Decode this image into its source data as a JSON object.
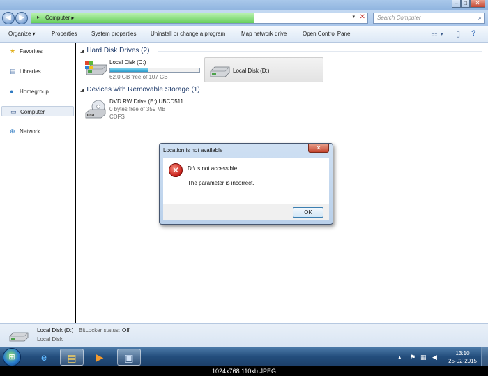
{
  "window": {
    "controls": {
      "minimize": "‒",
      "maximize": "□",
      "close": "✕"
    }
  },
  "address": {
    "arrow": "▸",
    "path": "Computer",
    "separator": "▸",
    "search_placeholder": "Search Computer"
  },
  "toolbar": {
    "items": [
      "Organize ▾",
      "Properties",
      "System properties",
      "Uninstall or change a program",
      "Map network drive",
      "Open Control Panel"
    ]
  },
  "nav": {
    "items": [
      {
        "label": "Favorites",
        "icon": "star-icon"
      },
      {
        "label": "Libraries",
        "icon": "library-icon"
      },
      {
        "label": "Homegroup",
        "icon": "homegroup-icon"
      },
      {
        "label": "Computer",
        "icon": "computer-icon",
        "selected": true
      },
      {
        "label": "Network",
        "icon": "network-icon"
      }
    ]
  },
  "content": {
    "groups": [
      {
        "label": "Hard Disk Drives (2)"
      },
      {
        "label": "Devices with Removable Storage (1)"
      }
    ],
    "drives": {
      "c": {
        "name": "Local Disk (C:)",
        "free": "62.0 GB free of 107 GB",
        "used_fraction": 0.42
      },
      "d": {
        "name": "Local Disk (D:)"
      },
      "e": {
        "name": "DVD RW Drive (E:) UBCD511",
        "free": "0 bytes free of 359 MB",
        "fs": "CDFS"
      }
    }
  },
  "dialog": {
    "title": "Location is not available",
    "close": "✕",
    "message": "D:\\ is not accessible.",
    "detail": "The parameter is incorrect.",
    "ok": "OK"
  },
  "details": {
    "name": "Local Disk (D:)",
    "bitlocker_label": "BitLocker status:",
    "bitlocker_value": "Off",
    "type": "Local Disk"
  },
  "taskbar": {
    "time": "13:10",
    "date": "25-02-2015"
  },
  "caption": "1024x768  110kb  JPEG",
  "colors": {
    "address_fill": "#66cf5a",
    "drive_bar": "#2a9ccb",
    "error_red": "#c8201a"
  }
}
